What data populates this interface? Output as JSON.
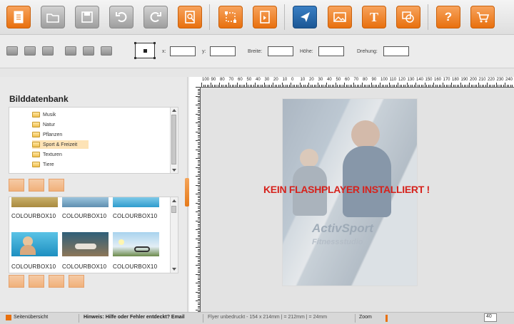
{
  "toolbar": {
    "buttons": [
      {
        "icon": "new-document-icon",
        "style": "orange"
      },
      {
        "icon": "open-folder-icon",
        "style": "gray"
      },
      {
        "icon": "save-icon",
        "style": "gray"
      },
      {
        "icon": "undo-icon",
        "style": "gray"
      },
      {
        "icon": "redo-icon",
        "style": "gray"
      },
      {
        "icon": "edit-document-icon",
        "style": "orange"
      },
      {
        "icon": "crop-frame-icon",
        "style": "orange"
      },
      {
        "icon": "page-icon",
        "style": "orange"
      },
      {
        "icon": "pointer-icon",
        "style": "blue"
      },
      {
        "icon": "image-icon",
        "style": "orange"
      },
      {
        "icon": "text-icon",
        "style": "orange"
      },
      {
        "icon": "shape-icon",
        "style": "orange"
      },
      {
        "icon": "help-icon",
        "style": "orange"
      },
      {
        "icon": "cart-icon",
        "style": "orange"
      }
    ],
    "text_label": "T",
    "help_label": "?"
  },
  "properties": {
    "x_label": "x:",
    "y_label": "y:",
    "width_label": "Breite:",
    "height_label": "Höhe:",
    "rotation_label": "Drehung:"
  },
  "left_panel": {
    "title": "Bilddatenbank",
    "tree_items": [
      "Musik",
      "Natur",
      "Pflanzen",
      "Sport & Freizeit",
      "Texturen",
      "Tiere"
    ],
    "selected_item": "Sport & Freizeit",
    "gallery_captions": [
      "COLOURBOX10",
      "COLOURBOX10",
      "COLOURBOX10",
      "COLOURBOX10",
      "COLOURBOX10",
      "COLOURBOX10"
    ]
  },
  "canvas": {
    "message": "KEIN FLASHPLAYER INSTALLIERT !",
    "brand_main": "ActivSport",
    "brand_sub": "Fitnessstudio"
  },
  "ruler_top_labels": [
    "100",
    "90",
    "80",
    "70",
    "60",
    "50",
    "40",
    "30",
    "20",
    "10",
    "0",
    "10",
    "20",
    "30",
    "40",
    "50",
    "60",
    "70",
    "80",
    "90",
    "100",
    "110",
    "120",
    "130",
    "140",
    "150",
    "160",
    "170",
    "180",
    "190",
    "200",
    "210",
    "220",
    "230",
    "240"
  ],
  "statusbar": {
    "pages": "Seitenübersicht",
    "hint": "Hinweis: Hilfe oder Fehler entdeckt? Email",
    "info": "Flyer unbedruckt - 154 x 214mm | = 212mm | = 24mm",
    "zoom_label": "Zoom",
    "zoom_value": "40"
  },
  "colors": {
    "accent_orange": "#e8700e",
    "active_blue": "#1c5795",
    "warning_red": "#d6221c"
  }
}
